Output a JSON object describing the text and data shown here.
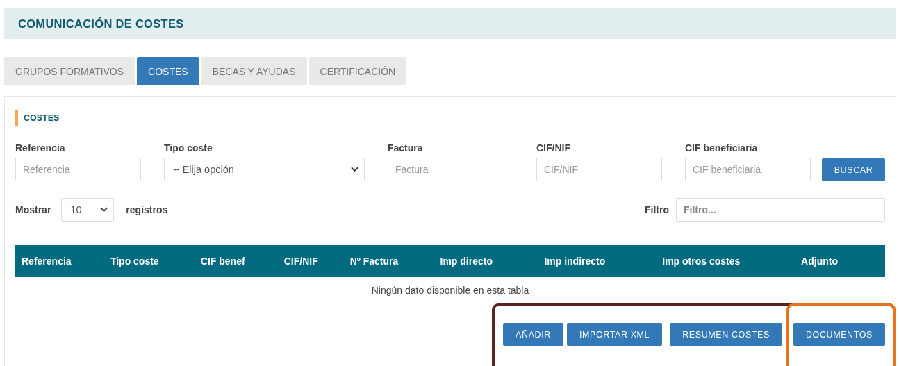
{
  "header": {
    "title": "COMUNICACIÓN DE COSTES"
  },
  "tabs": [
    {
      "label": "GRUPOS FORMATIVOS",
      "selected": false
    },
    {
      "label": "COSTES",
      "selected": true
    },
    {
      "label": "BECAS Y AYUDAS",
      "selected": false
    },
    {
      "label": "CERTIFICACIÓN",
      "selected": false
    }
  ],
  "section": {
    "title": "COSTES"
  },
  "filters": [
    {
      "kind": "text",
      "label": "Referencia",
      "placeholder": "Referencia"
    },
    {
      "kind": "select",
      "label": "Tipo coste",
      "value": "-- Elija opción"
    },
    {
      "kind": "text",
      "label": "Factura",
      "placeholder": "Factura"
    },
    {
      "kind": "text",
      "label": "CIF/NIF",
      "placeholder": "CIF/NIF"
    },
    {
      "kind": "text",
      "label": "CIF beneficiaria",
      "placeholder": "CIF beneficiaria"
    }
  ],
  "search_button": "BUSCAR",
  "length": {
    "before": "Mostrar",
    "value": "10",
    "after": "registros"
  },
  "filter": {
    "label": "Filtro",
    "placeholder": "Filtro..."
  },
  "table": {
    "columns": [
      "Referencia",
      "Tipo coste",
      "CIF benef",
      "CIF/NIF",
      "Nº Factura",
      "Imp directo",
      "Imp indirecto",
      "Imp otros costes",
      "Adjunto"
    ],
    "empty": "Ningún dato disponible en esta tabla"
  },
  "actions": {
    "color": "#5b2424",
    "buttons": [
      {
        "label": "AÑADIR"
      },
      {
        "label": "IMPORTAR XML"
      },
      {
        "label": "RESUMEN COSTES"
      },
      {
        "label": "DOCUMENTOS",
        "color": "#e8741c"
      }
    ]
  }
}
